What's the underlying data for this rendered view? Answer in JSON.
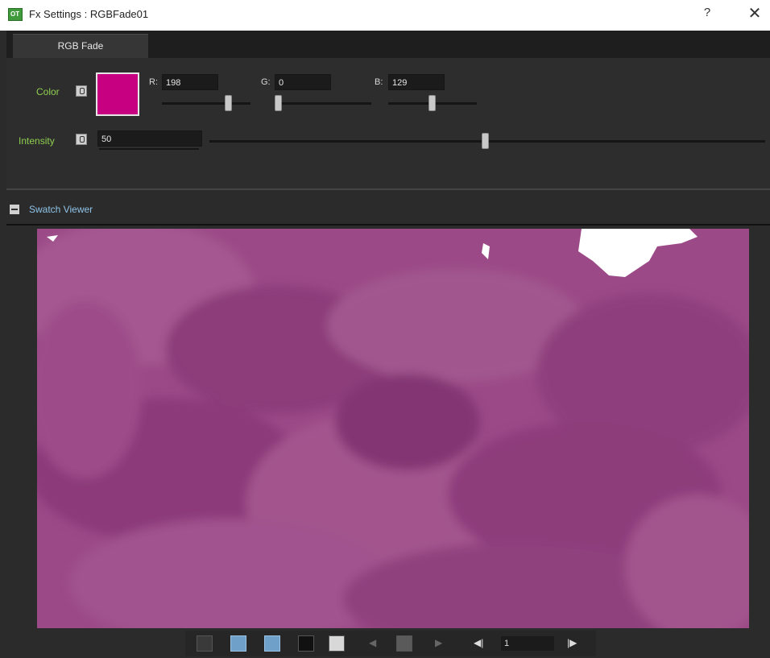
{
  "window": {
    "title": "Fx Settings : RGBFade01",
    "app_icon_text": "OT",
    "help_label": "?",
    "close_label": "✕"
  },
  "tabs": [
    {
      "label": "RGB Fade",
      "active": true
    }
  ],
  "color": {
    "label": "Color",
    "swatch_hex": "#c60081",
    "r_label": "R:",
    "r_value": "198",
    "g_label": "G:",
    "g_value": "0",
    "b_label": "B:",
    "b_value": "129",
    "r_max": 255,
    "g_max": 255,
    "b_max": 255
  },
  "intensity": {
    "label": "Intensity",
    "value": "50",
    "max": 100
  },
  "swatch_viewer": {
    "title": "Swatch Viewer",
    "collapse_icon": "minus-icon"
  },
  "toolbar": {
    "buttons": [
      {
        "icon": "checkerboard-icon",
        "active": false
      },
      {
        "icon": "eye-icon",
        "active": true
      },
      {
        "icon": "frame-icon",
        "active": true
      },
      {
        "icon": "black-bg-icon",
        "active": false
      },
      {
        "icon": "white-bg-icon",
        "active": false
      }
    ],
    "prev_glyph": "◀",
    "lock_icon": "lock-icon",
    "next_glyph": "▶",
    "first_frame_glyph": "◀|",
    "frame_value": "1",
    "last_frame_glyph": "|▶"
  },
  "colors": {
    "accent_green": "#8fcf4f",
    "accent_blue": "#8fc4e8",
    "panel_bg": "#2b2b2b",
    "active_button": "#6ea0c9"
  }
}
